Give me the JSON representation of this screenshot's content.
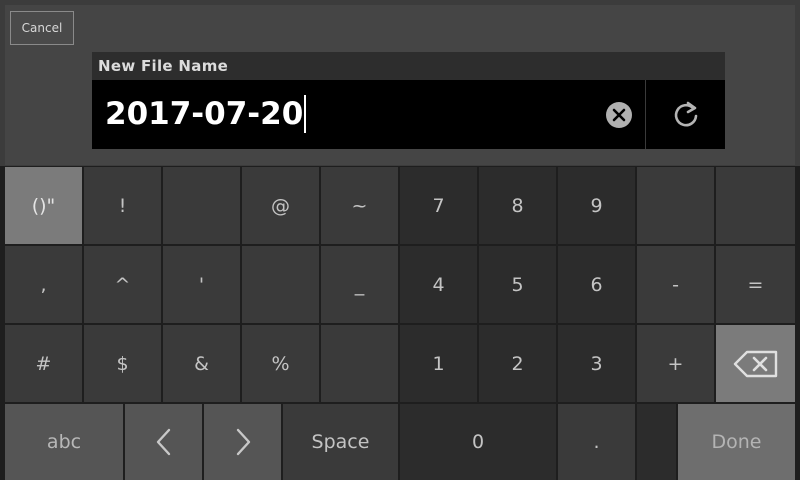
{
  "dialog": {
    "cancel_label": "Cancel",
    "field_label": "New File Name",
    "field_value": "2017-07-20",
    "clear_icon": "clear-x-circle-icon",
    "refresh_icon": "refresh-icon"
  },
  "keyboard": {
    "row1": [
      "()\"",
      "!",
      "",
      "@",
      "~",
      "7",
      "8",
      "9",
      "",
      ""
    ],
    "row2": [
      ",",
      "^",
      "'",
      "",
      "_",
      "4",
      "5",
      "6",
      "-",
      "="
    ],
    "row3": [
      "#",
      "$",
      "&",
      "%",
      "",
      "1",
      "2",
      "3",
      "+",
      ""
    ],
    "row4": {
      "abc": "abc",
      "space": "Space",
      "zero": "0",
      "dot": ".",
      "done": "Done"
    },
    "backspace_icon": "backspace-icon",
    "left_icon": "chevron-left-icon",
    "right_icon": "chevron-right-icon"
  },
  "colors": {
    "background": "#3c3c3c",
    "field_bg": "#000000",
    "key_bg": "#3a3a3a",
    "num_key_bg": "#2c2c2c",
    "active_key_bg": "#7b7b7b",
    "text": "#c4c4c4"
  }
}
